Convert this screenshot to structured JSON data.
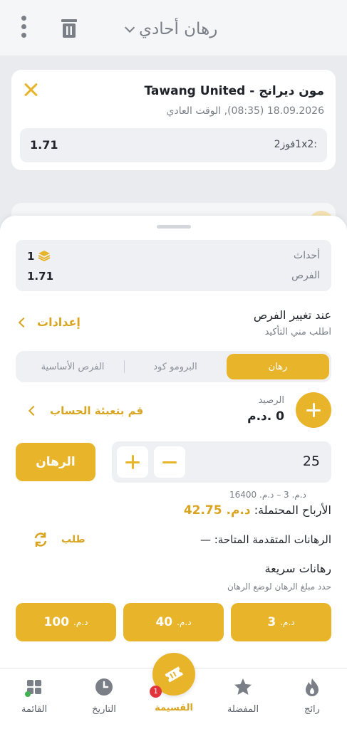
{
  "header": {
    "title": "رهان أحادي",
    "icons": {
      "menu": "kebab-icon",
      "delete": "trash-icon",
      "dropdown": "chevron-down-icon"
    }
  },
  "bet": {
    "match": "مون ديرانج - Tawang United",
    "datetime": "18.09.2026 (08:35), الوقت العادي",
    "market": ":1x2فوز2",
    "odds": "1.71"
  },
  "summary": {
    "events_label": "أحداث",
    "events_value": "1",
    "odds_label": "الفرص",
    "odds_value": "1.71"
  },
  "odds_change": {
    "title": "عند تغيير الفرص",
    "value": "اطلب مني التأكيد",
    "settings_label": "إعدادات"
  },
  "tabs": [
    {
      "label": "رهان",
      "active": true
    },
    {
      "label": "البرومو كود",
      "active": false
    },
    {
      "label": "الفرص الأساسية",
      "active": false
    }
  ],
  "balance": {
    "label": "الرصيد",
    "value": "0 .د.م",
    "topup_label": "قم بتعبئة الحساب"
  },
  "stake": {
    "value": "25",
    "bet_button": "الرهان",
    "range": "د.م. 3 – د.م. 16400"
  },
  "winnings": {
    "label": "الأرباح المحتملة:",
    "value": "د.م. 42.75"
  },
  "advanced": {
    "label": "الرهانات المتقدمة المتاحة: —",
    "request_label": "طلب"
  },
  "quick": {
    "title": "رهانات سريعة",
    "subtitle": "حدد مبلغ الرهان لوضع الرهان",
    "currency": "د.م.",
    "amounts": [
      "3",
      "40",
      "100"
    ]
  },
  "nav": {
    "popular": "رائج",
    "favorites": "المفضلة",
    "coupon": "القسيمة",
    "coupon_badge": "1",
    "history": "التاريخ",
    "menu": "القائمة"
  },
  "colors": {
    "accent": "#e8b42a",
    "accent_text": "#d9a520",
    "badge": "#e2353b"
  }
}
